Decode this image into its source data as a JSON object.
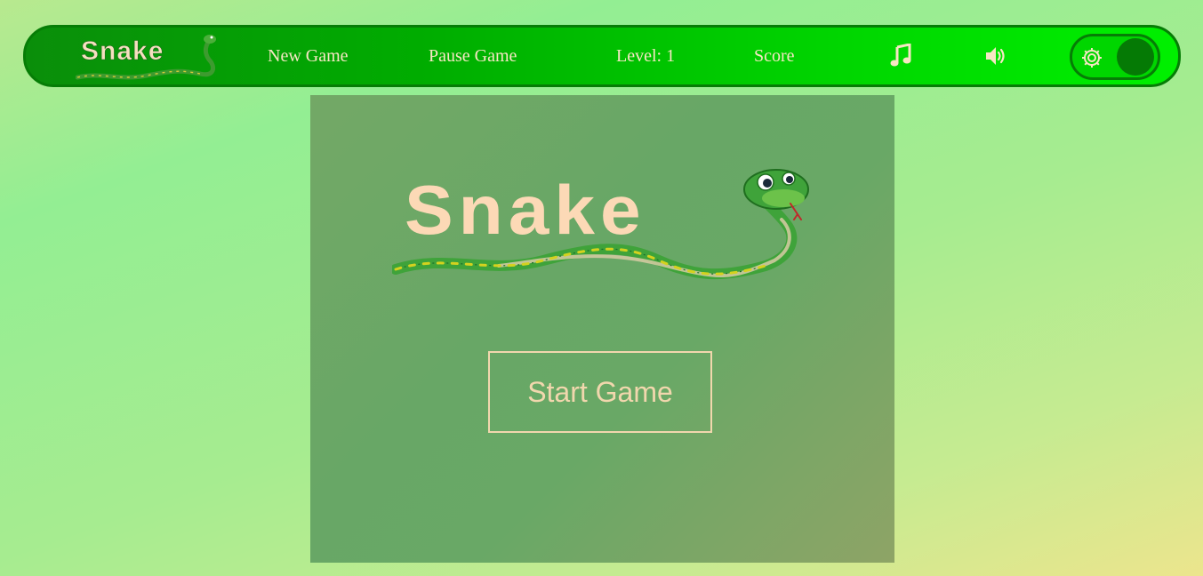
{
  "brand": {
    "logo_text": "Snake"
  },
  "nav": {
    "new_game": "New Game",
    "pause_game": "Pause Game",
    "level": "Level: 1",
    "score": "Score",
    "music_icon": "music-note-icon",
    "sound_icon": "speaker-volume-icon",
    "settings_icon": "gear-icon"
  },
  "board": {
    "logo_text": "Snake",
    "start_button": "Start Game"
  },
  "colors": {
    "nav_dark": "#0a8e0a",
    "nav_light": "#00f000",
    "text_cream": "#f7e6c4",
    "board_green": "#68a766",
    "logo_peach": "#fcd9b6",
    "snake_green": "#3fa33a",
    "snake_spots": "#d4d21e"
  }
}
